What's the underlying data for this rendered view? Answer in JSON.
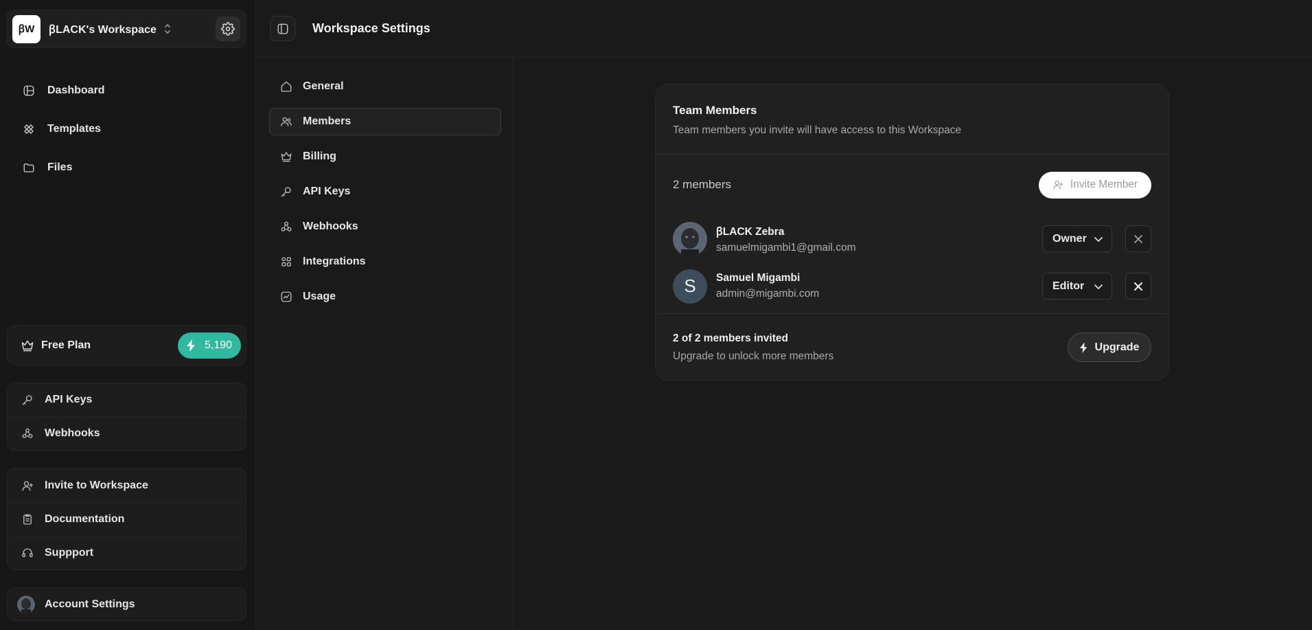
{
  "workspace": {
    "logo_text": "ꞵW",
    "name": "ꞵLACK's Workspace"
  },
  "sidebar": {
    "nav": [
      {
        "label": "Dashboard",
        "icon": "layout-icon"
      },
      {
        "label": "Templates",
        "icon": "templates-icon"
      },
      {
        "label": "Files",
        "icon": "folder-icon"
      }
    ],
    "plan": {
      "label": "Free Plan",
      "credits": "5,190"
    },
    "quick_links": [
      {
        "label": "API Keys",
        "icon": "key-icon"
      },
      {
        "label": "Webhooks",
        "icon": "webhook-icon"
      }
    ],
    "help_links": [
      {
        "label": "Invite to Workspace",
        "icon": "user-plus-icon"
      },
      {
        "label": "Documentation",
        "icon": "clipboard-icon"
      },
      {
        "label": "Suppport",
        "icon": "headset-icon"
      }
    ],
    "account": {
      "label": "Account Settings"
    }
  },
  "header": {
    "title": "Workspace Settings"
  },
  "settings_nav": [
    {
      "label": "General",
      "icon": "home-icon"
    },
    {
      "label": "Members",
      "icon": "users-icon",
      "active": true
    },
    {
      "label": "Billing",
      "icon": "crown-icon"
    },
    {
      "label": "API Keys",
      "icon": "key-icon"
    },
    {
      "label": "Webhooks",
      "icon": "webhook-icon"
    },
    {
      "label": "Integrations",
      "icon": "grid-icon"
    },
    {
      "label": "Usage",
      "icon": "chart-icon"
    }
  ],
  "team": {
    "title": "Team Members",
    "subtitle": "Team members you invite will have access to this Workspace",
    "count": "2 members",
    "invite_label": "Invite Member",
    "members": [
      {
        "name": "ꞵLACK Zebra",
        "email": "samuelmigambi1@gmail.com",
        "role": "Owner",
        "avatar": "photo"
      },
      {
        "name": "Samuel Migambi",
        "email": "admin@migambi.com",
        "role": "Editor",
        "avatar_letter": "S"
      }
    ],
    "footer": {
      "title": "2 of 2 members invited",
      "subtitle": "Upgrade to unlock more members",
      "upgrade_label": "Upgrade"
    }
  },
  "colors": {
    "accent": "#2fb9a0",
    "background": "#1a1a1a",
    "sidebar": "#171717"
  }
}
